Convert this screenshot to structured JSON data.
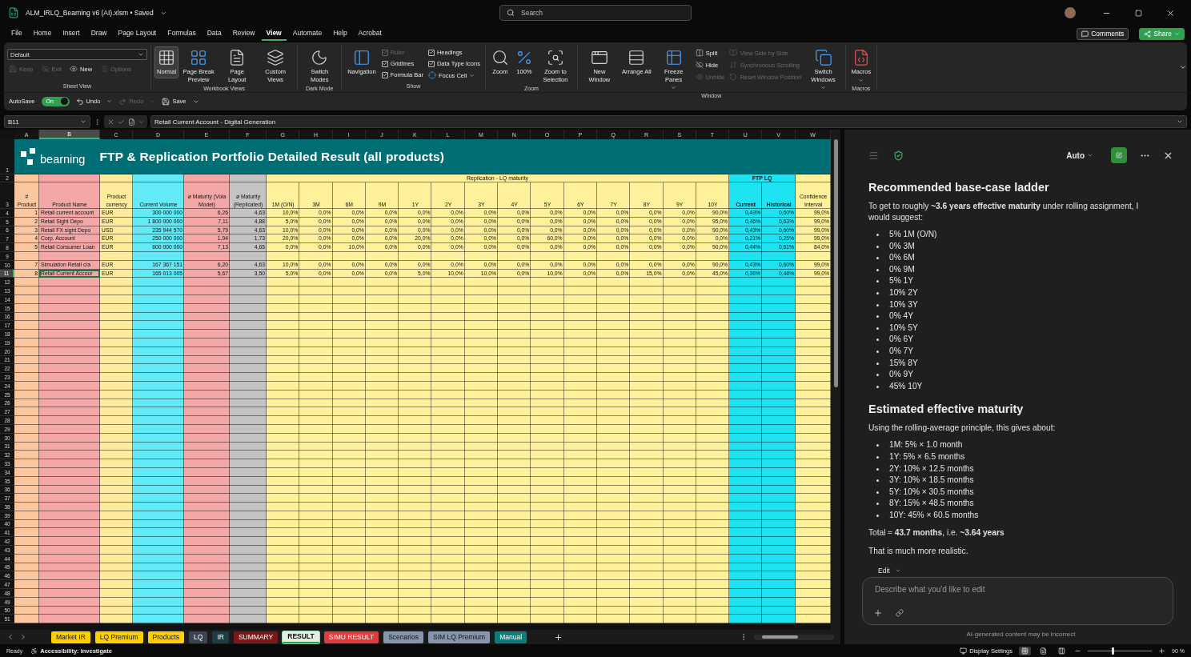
{
  "title_bar": {
    "file_name": "ALM_IRLQ_Bearning v6 (AI).xlsm • Saved",
    "search": {
      "placeholder": "Search"
    }
  },
  "menu": [
    {
      "label": "File",
      "selected": false
    },
    {
      "label": "Home",
      "selected": false
    },
    {
      "label": "Insert",
      "selected": false
    },
    {
      "label": "Draw",
      "selected": false
    },
    {
      "label": "Page Layout",
      "selected": false
    },
    {
      "label": "Formulas",
      "selected": false
    },
    {
      "label": "Data",
      "selected": false
    },
    {
      "label": "Review",
      "selected": false
    },
    {
      "label": "View",
      "selected": true
    },
    {
      "label": "Automate",
      "selected": false
    },
    {
      "label": "Help",
      "selected": false
    },
    {
      "label": "Acrobat",
      "selected": false
    }
  ],
  "comments": "Comments",
  "share": "Share",
  "ribbon": {
    "groups": [
      {
        "label": "Sheet View",
        "columns": [
          {
            "kind": "sheetview",
            "items": [
              {
                "kind": "select",
                "label": "Default"
              },
              {
                "kind": "small",
                "label": "Keep",
                "disabled": true
              },
              {
                "kind": "small",
                "label": "Exit",
                "disabled": true
              },
              {
                "kind": "small",
                "label": "New",
                "disabled": false
              },
              {
                "kind": "small",
                "label": "Options",
                "disabled": true
              }
            ]
          }
        ]
      },
      {
        "label": "Workbook Views",
        "columns": [
          {
            "kind": "large",
            "items": [
              {
                "kind": "large",
                "label": "Normal",
                "selected": true
              }
            ]
          },
          {
            "kind": "large",
            "items": [
              {
                "kind": "large",
                "label": "Page Break Preview",
                "selected": false
              }
            ]
          },
          {
            "kind": "large",
            "items": [
              {
                "kind": "large",
                "label": "Page Layout",
                "selected": false
              }
            ]
          },
          {
            "kind": "large",
            "items": [
              {
                "kind": "large",
                "label": "Custom Views",
                "selected": false
              }
            ]
          }
        ]
      },
      {
        "label": "Dark Mode",
        "columns": [
          {
            "kind": "large",
            "items": [
              {
                "kind": "large",
                "label": "Switch Modes",
                "selected": false
              }
            ]
          }
        ]
      },
      {
        "label": "Show",
        "columns": [
          {
            "kind": "large",
            "items": [
              {
                "kind": "large",
                "label": "Navigation",
                "selected": false
              }
            ]
          },
          {
            "kind": "stack",
            "items": [
              {
                "kind": "check",
                "label": "Ruler",
                "checked": true,
                "disabled": true
              },
              {
                "kind": "check",
                "label": "Gridlines",
                "checked": true,
                "disabled": false
              },
              {
                "kind": "check",
                "label": "Formula Bar",
                "checked": true,
                "disabled": false
              }
            ]
          },
          {
            "kind": "stack",
            "items": [
              {
                "kind": "check",
                "label": "Headings",
                "checked": true,
                "disabled": false
              },
              {
                "kind": "check",
                "label": "Data Type Icons",
                "checked": true,
                "disabled": false
              },
              {
                "kind": "small-dropdown",
                "label": "Focus Cell",
                "disabled": false
              }
            ]
          }
        ]
      },
      {
        "label": "Zoom",
        "columns": [
          {
            "kind": "large",
            "items": [
              {
                "kind": "large",
                "label": "Zoom",
                "selected": false
              }
            ]
          },
          {
            "kind": "large",
            "items": [
              {
                "kind": "large",
                "label": "100%",
                "selected": false
              }
            ]
          },
          {
            "kind": "large",
            "items": [
              {
                "kind": "large",
                "label": "Zoom to Selection",
                "selected": false
              }
            ]
          }
        ]
      },
      {
        "label": "Window",
        "columns": [
          {
            "kind": "large",
            "items": [
              {
                "kind": "large",
                "label": "New Window",
                "selected": false
              }
            ]
          },
          {
            "kind": "large",
            "items": [
              {
                "kind": "large",
                "label": "Arrange All",
                "selected": false
              }
            ]
          },
          {
            "kind": "large",
            "items": [
              {
                "kind": "large-dropdown",
                "label": "Freeze Panes",
                "selected": false
              }
            ]
          },
          {
            "kind": "stack",
            "items": [
              {
                "kind": "small",
                "label": "Split",
                "disabled": false
              },
              {
                "kind": "small",
                "label": "Hide",
                "disabled": false
              },
              {
                "kind": "small",
                "label": "Unhide",
                "disabled": true
              }
            ]
          },
          {
            "kind": "stack",
            "items": [
              {
                "kind": "small",
                "label": "View Side by Side",
                "disabled": true
              },
              {
                "kind": "small",
                "label": "Synchronous Scrolling",
                "disabled": true
              },
              {
                "kind": "small",
                "label": "Reset Window Position",
                "disabled": true
              }
            ]
          },
          {
            "kind": "large",
            "items": [
              {
                "kind": "large-dropdown",
                "label": "Switch Windows",
                "selected": false
              }
            ]
          }
        ]
      },
      {
        "label": "Macros",
        "columns": [
          {
            "kind": "large",
            "items": [
              {
                "kind": "large-dropdown",
                "label": "Macros",
                "selected": false
              }
            ]
          }
        ]
      }
    ]
  },
  "quick_access": {
    "autosave": {
      "label": "AutoSave",
      "state_text": "On",
      "on": true
    },
    "undo": "Undo",
    "redo": {
      "label": "Redo",
      "disabled": true
    },
    "save": "Save"
  },
  "formula_bar": {
    "name_box": "B11",
    "formula": "Retail Current Account - Digital Generation"
  },
  "sheet": {
    "columns": [
      {
        "label": "A",
        "selected": false
      },
      {
        "label": "B",
        "selected": true
      },
      {
        "label": "C",
        "selected": false
      },
      {
        "label": "D",
        "selected": false
      },
      {
        "label": "E",
        "selected": false
      },
      {
        "label": "F",
        "selected": false
      },
      {
        "label": "G",
        "selected": false
      },
      {
        "label": "H",
        "selected": false
      },
      {
        "label": "I",
        "selected": false
      },
      {
        "label": "J",
        "selected": false
      },
      {
        "label": "K",
        "selected": false
      },
      {
        "label": "L",
        "selected": false
      },
      {
        "label": "M",
        "selected": false
      },
      {
        "label": "N",
        "selected": false
      },
      {
        "label": "O",
        "selected": false
      },
      {
        "label": "P",
        "selected": false
      },
      {
        "label": "Q",
        "selected": false
      },
      {
        "label": "R",
        "selected": false
      },
      {
        "label": "S",
        "selected": false
      },
      {
        "label": "T",
        "selected": false
      },
      {
        "label": "U",
        "selected": false
      },
      {
        "label": "V",
        "selected": false
      },
      {
        "label": "W",
        "selected": false
      }
    ],
    "rows": [
      {
        "label": "1",
        "selected": false
      },
      {
        "label": "2",
        "selected": false
      },
      {
        "label": "3",
        "selected": false
      },
      {
        "label": "4",
        "selected": false
      },
      {
        "label": "5",
        "selected": false
      },
      {
        "label": "6",
        "selected": false
      },
      {
        "label": "7",
        "selected": false
      },
      {
        "label": "8",
        "selected": false
      },
      {
        "label": "9",
        "selected": false
      },
      {
        "label": "10",
        "selected": false
      },
      {
        "label": "11",
        "selected": true
      },
      {
        "label": "12",
        "selected": false
      },
      {
        "label": "13",
        "selected": false
      },
      {
        "label": "14",
        "selected": false
      },
      {
        "label": "15",
        "selected": false
      },
      {
        "label": "16",
        "selected": false
      },
      {
        "label": "17",
        "selected": false
      },
      {
        "label": "18",
        "selected": false
      },
      {
        "label": "19",
        "selected": false
      },
      {
        "label": "20",
        "selected": false
      },
      {
        "label": "21",
        "selected": false
      },
      {
        "label": "22",
        "selected": false
      },
      {
        "label": "23",
        "selected": false
      },
      {
        "label": "24",
        "selected": false
      },
      {
        "label": "25",
        "selected": false
      },
      {
        "label": "26",
        "selected": false
      },
      {
        "label": "27",
        "selected": false
      },
      {
        "label": "28",
        "selected": false
      },
      {
        "label": "29",
        "selected": false
      },
      {
        "label": "30",
        "selected": false
      },
      {
        "label": "31",
        "selected": false
      },
      {
        "label": "32",
        "selected": false
      },
      {
        "label": "33",
        "selected": false
      },
      {
        "label": "34",
        "selected": false
      },
      {
        "label": "35",
        "selected": false
      },
      {
        "label": "36",
        "selected": false
      },
      {
        "label": "37",
        "selected": false
      },
      {
        "label": "38",
        "selected": false
      },
      {
        "label": "39",
        "selected": false
      },
      {
        "label": "40",
        "selected": false
      },
      {
        "label": "41",
        "selected": false
      },
      {
        "label": "42",
        "selected": false
      },
      {
        "label": "43",
        "selected": false
      },
      {
        "label": "44",
        "selected": false
      },
      {
        "label": "45",
        "selected": false
      },
      {
        "label": "46",
        "selected": false
      },
      {
        "label": "47",
        "selected": false
      },
      {
        "label": "48",
        "selected": false
      },
      {
        "label": "49",
        "selected": false
      },
      {
        "label": "50",
        "selected": false
      },
      {
        "label": "51",
        "selected": false
      }
    ],
    "logo": "bearning",
    "title": "FTP & Replication Portfolio Detailed Result (all products)",
    "group_headers": [
      "Replication - LQ maturity",
      "FTP LQ"
    ],
    "header": [
      "# Product",
      "Product Name",
      "Product currency",
      "Current Volume",
      "ø Maturity (Vola Model)",
      "ø Maturity (Replicated)",
      "1M (O/N)",
      "3M",
      "6M",
      "9M",
      "1Y",
      "2Y",
      "3Y",
      "4Y",
      "5Y",
      "6Y",
      "7Y",
      "8Y",
      "9Y",
      "10Y",
      "Current",
      "Historical",
      "Confidence Interval"
    ],
    "data": [
      {
        "kind": "data",
        "cells": [
          "1",
          "Retail current account",
          "EUR",
          "300 000 000",
          "6,26",
          "4,63",
          "10,0%",
          "0,0%",
          "0,0%",
          "0,0%",
          "0,0%",
          "0,0%",
          "0,0%",
          "0,0%",
          "0,0%",
          "0,0%",
          "0,0%",
          "0,0%",
          "0,0%",
          "90,0%",
          "0,43%",
          "0,60%",
          "99,0%"
        ]
      },
      {
        "kind": "data",
        "cells": [
          "2",
          "Retail Sight Depo",
          "EUR",
          "1 800 000 000",
          "7,11",
          "4,88",
          "5,0%",
          "0,0%",
          "0,0%",
          "0,0%",
          "0,0%",
          "0,0%",
          "0,0%",
          "0,0%",
          "0,0%",
          "0,0%",
          "0,0%",
          "0,0%",
          "0,0%",
          "95,0%",
          "0,46%",
          "0,63%",
          "99,0%"
        ]
      },
      {
        "kind": "data",
        "cells": [
          "3",
          "Retail FX sight Depo",
          "USD",
          "235 944 570",
          "5,79",
          "4,63",
          "10,0%",
          "0,0%",
          "0,0%",
          "0,0%",
          "0,0%",
          "0,0%",
          "0,0%",
          "0,0%",
          "0,0%",
          "0,0%",
          "0,0%",
          "0,0%",
          "0,0%",
          "90,0%",
          "0,43%",
          "0,60%",
          "99,0%"
        ]
      },
      {
        "kind": "data",
        "cells": [
          "4",
          "Corp. Account",
          "EUR",
          "250 000 000",
          "1,94",
          "1,73",
          "20,0%",
          "0,0%",
          "0,0%",
          "0,0%",
          "20,0%",
          "0,0%",
          "0,0%",
          "0,0%",
          "60,0%",
          "0,0%",
          "0,0%",
          "0,0%",
          "0,0%",
          "0,0%",
          "0,21%",
          "0,25%",
          "99,0%"
        ]
      },
      {
        "kind": "data",
        "cells": [
          "5",
          "Retail Consumer Loan",
          "EUR",
          "600 000 000",
          "7,13",
          "4,65",
          "0,0%",
          "0,0%",
          "10,0%",
          "0,0%",
          "0,0%",
          "0,0%",
          "0,0%",
          "0,0%",
          "0,0%",
          "0,0%",
          "0,0%",
          "0,0%",
          "0,0%",
          "90,0%",
          "0,44%",
          "0,61%",
          "84,0%"
        ]
      },
      {
        "kind": "blank"
      },
      {
        "kind": "data",
        "cells": [
          "7",
          "Simulation Retail c/a",
          "EUR",
          "167 367 151",
          "6,20",
          "4,63",
          "10,0%",
          "0,0%",
          "0,0%",
          "0,0%",
          "0,0%",
          "0,0%",
          "0,0%",
          "0,0%",
          "0,0%",
          "0,0%",
          "0,0%",
          "0,0%",
          "0,0%",
          "90,0%",
          "0,43%",
          "0,60%",
          "99,0%"
        ]
      },
      {
        "kind": "data",
        "cells": [
          "8",
          "Retail Current Accour",
          "EUR",
          "165 013 005",
          "5,67",
          "3,50",
          "5,0%",
          "0,0%",
          "0,0%",
          "0,0%",
          "5,0%",
          "10,0%",
          "10,0%",
          "0,0%",
          "10,0%",
          "0,0%",
          "0,0%",
          "15,0%",
          "0,0%",
          "45,0%",
          "0,36%",
          "0,48%",
          "99,0%"
        ]
      }
    ]
  },
  "sheet_tabs": [
    {
      "label": "Market IR",
      "color": "#ffd000",
      "selected": false
    },
    {
      "label": "LQ Premium",
      "color": "#ffd000",
      "selected": false
    },
    {
      "label": "Products",
      "color": "#ffd000",
      "selected": false
    },
    {
      "label": "LQ",
      "color": "#3b4450",
      "selected": false
    },
    {
      "label": "IR",
      "color": "#1c3d48",
      "selected": false
    },
    {
      "label": "SUMMARY",
      "color": "#7a1717",
      "selected": false
    },
    {
      "label": "RESULT",
      "color": "#dff0e1",
      "selected": true
    },
    {
      "label": "SIMU RESULT",
      "color": "#e23b3b",
      "selected": false
    },
    {
      "label": "Scenarios",
      "color": "#8596ae",
      "selected": false
    },
    {
      "label": "SIM LQ Premium",
      "color": "#8596ae",
      "selected": false
    },
    {
      "label": "Manual",
      "color": "#0b7d7c",
      "selected": false
    }
  ],
  "assistant": {
    "mode": "Auto",
    "heading_1": "Recommended base-case ladder",
    "intro": "To get to roughly **~3.6 years effective maturity** under rolling assignment, I would suggest:",
    "ladder": [
      "5% 1M (O/N)",
      "0% 3M",
      "0% 6M",
      "0% 9M",
      "5% 1Y",
      "10% 2Y",
      "10% 3Y",
      "0% 4Y",
      "10% 5Y",
      "0% 6Y",
      "0% 7Y",
      "15% 8Y",
      "0% 9Y",
      "45% 10Y"
    ],
    "heading_2": "Estimated effective maturity",
    "intro_2": "Using the rolling-average principle, this gives about:",
    "estimates": [
      "1M: 5% × 1.0 month",
      "1Y: 5% × 6.5 months",
      "2Y: 10% × 12.5 months",
      "3Y: 10% × 18.5 months",
      "5Y: 10% × 30.5 months",
      "8Y: 15% × 48.5 months",
      "10Y: 45% × 60.5 months"
    ],
    "total": "Total ≈ **43.7 months**, i.e. **~3.64 years**",
    "closing": "That is much more realistic.",
    "edit_menu": "Edit",
    "input": {
      "placeholder": "Describe what you'd like to edit"
    },
    "disclaimer": "AI-generated content may be incorrect"
  },
  "status_bar": {
    "status": "Ready",
    "accessibility": "Accessibility: Investigate",
    "display_settings": "Display Settings",
    "views": [
      {
        "selected": true
      },
      {
        "selected": false
      },
      {
        "selected": false
      }
    ],
    "zoom": {
      "level": 0.39,
      "reading": "90 %"
    }
  }
}
